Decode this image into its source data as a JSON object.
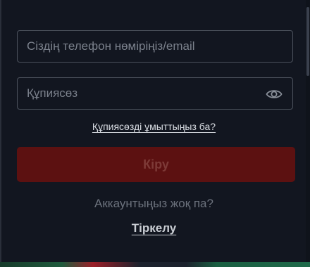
{
  "form": {
    "phone_placeholder": "Сіздің телефон нөміріңіз/email",
    "phone_value": "",
    "password_placeholder": "Құпиясөз",
    "password_value": "",
    "password_toggle_icon": "eye-icon",
    "forgot_password_link": "Құпиясөзді ұмыттыңыз ба?",
    "login_button": "Кіру",
    "no_account_text": "Аккаунтыңыз жоқ па?",
    "register_link": "Тіркелу"
  },
  "colors": {
    "background": "#121620",
    "field_border": "#4b515c",
    "login_button_bg": "#5c1111",
    "login_button_text": "#7d3a37",
    "muted_text": "#6c727d",
    "link_text": "#d9dde3"
  }
}
